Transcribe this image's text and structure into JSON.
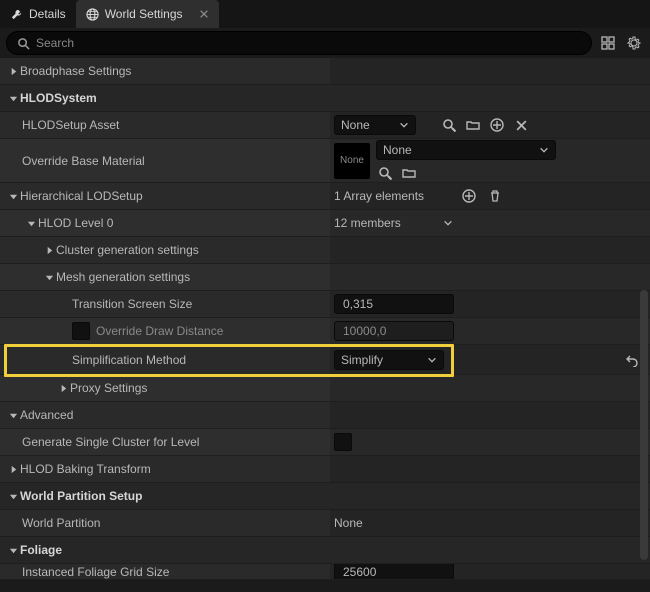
{
  "tabs": [
    {
      "label": "Details",
      "active": false
    },
    {
      "label": "World Settings",
      "active": true
    }
  ],
  "search": {
    "placeholder": "Search"
  },
  "sections": {
    "broadphase": {
      "label": "Broadphase Settings"
    },
    "hlodsystem": {
      "label": "HLODSystem"
    },
    "hlodsetup_asset": {
      "label": "HLODSetup Asset",
      "value": "None"
    },
    "override_base_material": {
      "label": "Override Base Material",
      "value": "None",
      "thumb": "None"
    },
    "hierarchical_lodsetup": {
      "label": "Hierarchical LODSetup",
      "summary": "1 Array elements"
    },
    "hlod_level0": {
      "label": "HLOD Level 0",
      "summary": "12 members"
    },
    "cluster_gen": {
      "label": "Cluster generation settings"
    },
    "mesh_gen": {
      "label": "Mesh generation settings"
    },
    "transition_screen_size": {
      "label": "Transition Screen Size",
      "value": "0,315"
    },
    "override_draw_distance": {
      "label": "Override Draw Distance",
      "value": "10000,0"
    },
    "simplification_method": {
      "label": "Simplification Method",
      "value": "Simplify"
    },
    "proxy_settings": {
      "label": "Proxy Settings"
    },
    "advanced": {
      "label": "Advanced"
    },
    "generate_single_cluster": {
      "label": "Generate Single Cluster for Level"
    },
    "hlod_baking_transform": {
      "label": "HLOD Baking Transform"
    },
    "world_partition_setup": {
      "label": "World Partition Setup"
    },
    "world_partition": {
      "label": "World Partition",
      "value": "None"
    },
    "foliage": {
      "label": "Foliage"
    },
    "instanced_foliage_grid": {
      "label": "Instanced Foliage Grid Size",
      "value": "25600"
    }
  }
}
